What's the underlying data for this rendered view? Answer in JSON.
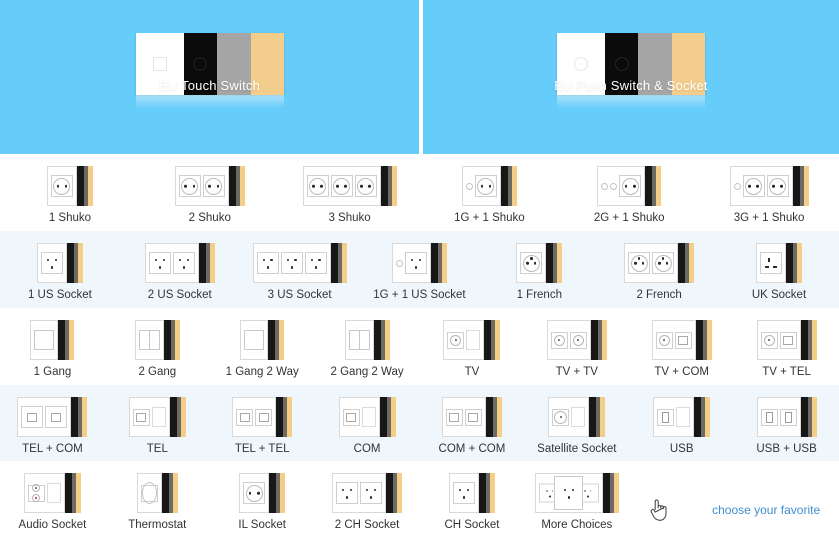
{
  "banners": [
    {
      "id": "eu-touch-switch",
      "label": "EU Touch Switch"
    },
    {
      "id": "eu-push-switch-socket",
      "label": "EU Push Switch & Socket"
    }
  ],
  "colors": {
    "banner_bg": "#66ccfa",
    "row_tint": "#eff7fd",
    "link": "#3f8ed0",
    "panel_white": "#ffffff",
    "panel_black": "#0b0b0b",
    "panel_gray": "#a5a5a5",
    "panel_tan": "#f3cd8b"
  },
  "rows": [
    {
      "tint": false,
      "items": [
        {
          "label": "1 Shuko",
          "kind": "schuko",
          "count": 1,
          "gangs": 0
        },
        {
          "label": "2 Shuko",
          "kind": "schuko",
          "count": 2,
          "gangs": 0
        },
        {
          "label": "3 Shuko",
          "kind": "schuko",
          "count": 3,
          "gangs": 0
        },
        {
          "label": "1G + 1 Shuko",
          "kind": "schuko",
          "count": 1,
          "gangs": 1
        },
        {
          "label": "2G + 1 Shuko",
          "kind": "schuko",
          "count": 1,
          "gangs": 2
        },
        {
          "label": "3G + 1 Shuko",
          "kind": "schuko",
          "count": 2,
          "gangs": 1
        }
      ]
    },
    {
      "tint": true,
      "items": [
        {
          "label": "1 US Socket",
          "kind": "us",
          "count": 1,
          "gangs": 0
        },
        {
          "label": "2 US Socket",
          "kind": "us",
          "count": 2,
          "gangs": 0
        },
        {
          "label": "3 US Socket",
          "kind": "us",
          "count": 3,
          "gangs": 0
        },
        {
          "label": "1G + 1 US Socket",
          "kind": "us",
          "count": 1,
          "gangs": 1
        },
        {
          "label": "1 French",
          "kind": "french",
          "count": 1,
          "gangs": 0
        },
        {
          "label": "2 French",
          "kind": "french",
          "count": 2,
          "gangs": 0
        },
        {
          "label": "UK Socket",
          "kind": "uk",
          "count": 1,
          "gangs": 0
        }
      ]
    },
    {
      "tint": false,
      "items": [
        {
          "label": "1 Gang",
          "kind": "gang",
          "count": 1,
          "gangs": 0
        },
        {
          "label": "2 Gang",
          "kind": "gang",
          "count": 2,
          "gangs": 0
        },
        {
          "label": "1 Gang 2 Way",
          "kind": "gang",
          "count": 1,
          "gangs": 0
        },
        {
          "label": "2 Gang 2 Way",
          "kind": "gang",
          "count": 2,
          "gangs": 0
        },
        {
          "label": "TV",
          "kind": "tv",
          "count": 1,
          "gangs": 0
        },
        {
          "label": "TV + TV",
          "kind": "tv",
          "count": 2,
          "gangs": 0
        },
        {
          "label": "TV + COM",
          "kind": "tvcom",
          "count": 2,
          "gangs": 0
        },
        {
          "label": "TV + TEL",
          "kind": "tvtel",
          "count": 2,
          "gangs": 0
        }
      ]
    },
    {
      "tint": true,
      "items": [
        {
          "label": "TEL + COM",
          "kind": "telcom",
          "count": 2,
          "gangs": 0
        },
        {
          "label": "TEL",
          "kind": "tel",
          "count": 1,
          "gangs": 0
        },
        {
          "label": "TEL + TEL",
          "kind": "tel",
          "count": 2,
          "gangs": 0
        },
        {
          "label": "COM",
          "kind": "com",
          "count": 1,
          "gangs": 0
        },
        {
          "label": "COM + COM",
          "kind": "com",
          "count": 2,
          "gangs": 0
        },
        {
          "label": "Satellite Socket",
          "kind": "sat",
          "count": 1,
          "gangs": 0
        },
        {
          "label": "USB",
          "kind": "usb",
          "count": 1,
          "gangs": 0
        },
        {
          "label": "USB + USB",
          "kind": "usb",
          "count": 2,
          "gangs": 0
        }
      ]
    },
    {
      "tint": false,
      "items": [
        {
          "label": "Audio Socket",
          "kind": "audio",
          "count": 1,
          "gangs": 0
        },
        {
          "label": "Thermostat",
          "kind": "thermo",
          "count": 1,
          "gangs": 0
        },
        {
          "label": "IL Socket",
          "kind": "il",
          "count": 1,
          "gangs": 0
        },
        {
          "label": "2 CH Socket",
          "kind": "ch",
          "count": 2,
          "gangs": 0
        },
        {
          "label": "CH Socket",
          "kind": "ch",
          "count": 1,
          "gangs": 0
        },
        {
          "label": "More Choices",
          "kind": "more",
          "count": 1,
          "gangs": 0
        }
      ]
    }
  ],
  "footer": {
    "cursor_icon": "pointing-hand-cursor",
    "favorite_link": "choose your favorite"
  }
}
